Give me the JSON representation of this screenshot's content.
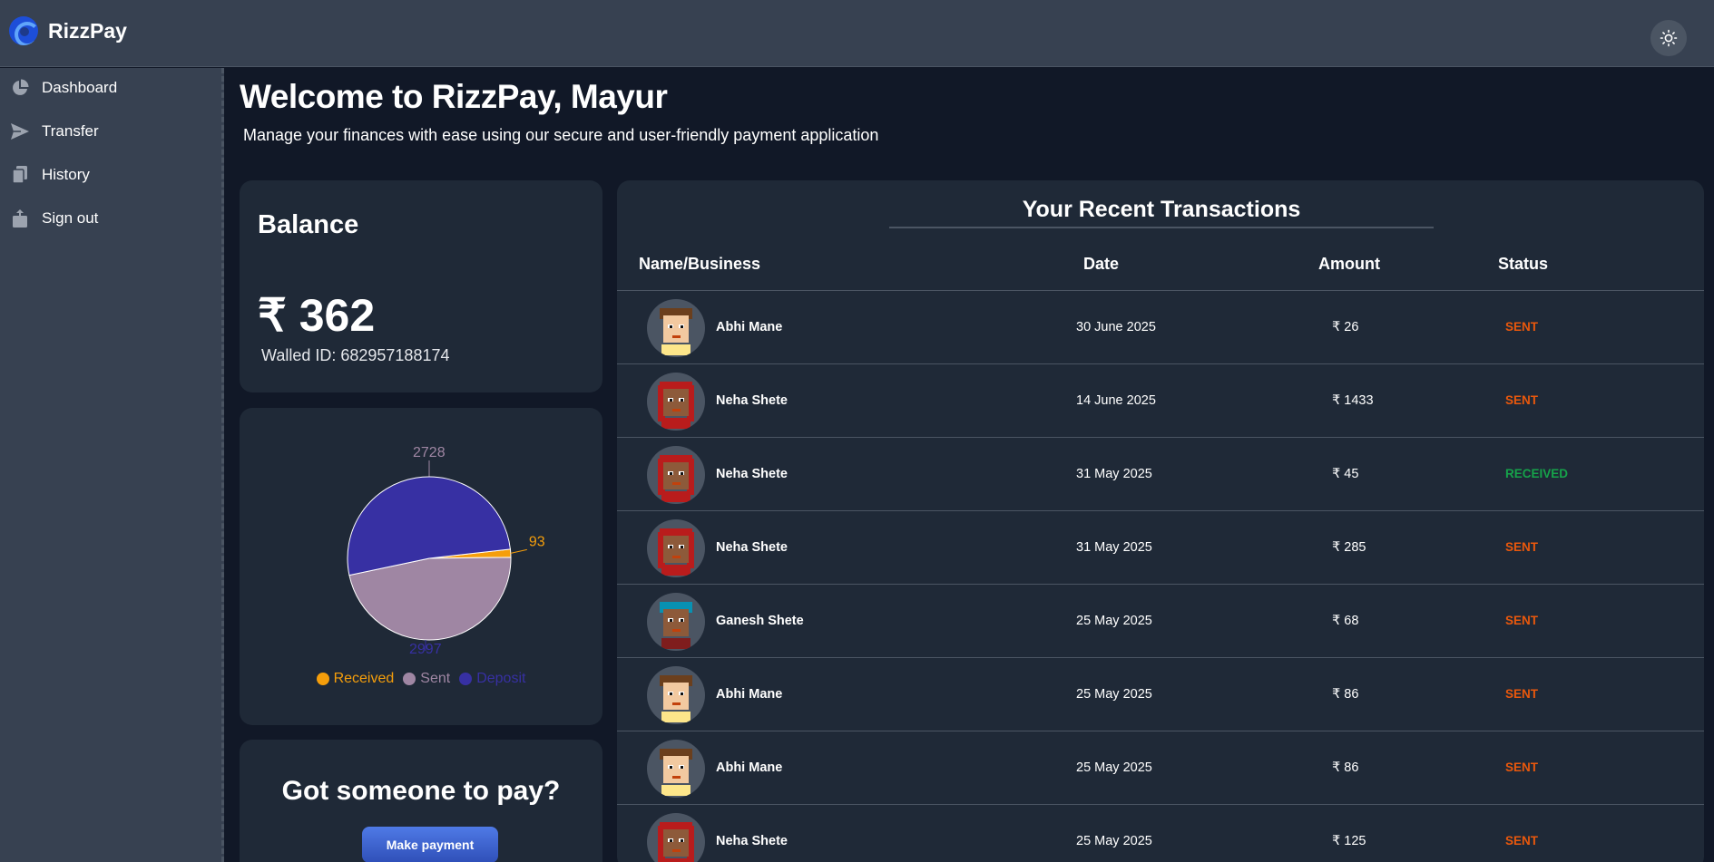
{
  "app": {
    "name": "RizzPay"
  },
  "sidebar": {
    "items": [
      {
        "label": "Dashboard",
        "icon": "pie-chart-icon"
      },
      {
        "label": "Transfer",
        "icon": "send-icon"
      },
      {
        "label": "History",
        "icon": "documents-icon"
      },
      {
        "label": "Sign out",
        "icon": "sign-out-icon"
      }
    ]
  },
  "header": {
    "title": "Welcome to RizzPay, Mayur",
    "subtitle": "Manage your finances with ease using our secure and user-friendly payment application"
  },
  "balance": {
    "title": "Balance",
    "amount": "₹ 362",
    "wallet_id": "Walled ID: 682957188174"
  },
  "chart_data": {
    "type": "pie",
    "slices": [
      {
        "name": "Received",
        "value": 93,
        "color": "#f59e0b"
      },
      {
        "name": "Sent",
        "value": 2728,
        "color": "#9f86a3"
      },
      {
        "name": "Deposit",
        "value": 2997,
        "color": "#3730a3"
      }
    ],
    "legend": "bottom"
  },
  "pay_card": {
    "title": "Got someone to pay?",
    "button": "Make payment"
  },
  "transactions": {
    "title": "Your Recent Transactions",
    "columns": [
      "Name/Business",
      "Date",
      "Amount",
      "Status"
    ],
    "rows": [
      {
        "name": "Abhi Mane",
        "date": "30 June 2025",
        "amount": "₹ 26",
        "status": "SENT",
        "avatar": "abhi"
      },
      {
        "name": "Neha Shete",
        "date": "14 June 2025",
        "amount": "₹ 1433",
        "status": "SENT",
        "avatar": "neha"
      },
      {
        "name": "Neha Shete",
        "date": "31 May 2025",
        "amount": "₹ 45",
        "status": "RECEIVED",
        "avatar": "neha"
      },
      {
        "name": "Neha Shete",
        "date": "31 May 2025",
        "amount": "₹ 285",
        "status": "SENT",
        "avatar": "neha"
      },
      {
        "name": "Ganesh Shete",
        "date": "25 May 2025",
        "amount": "₹ 68",
        "status": "SENT",
        "avatar": "ganesh"
      },
      {
        "name": "Abhi Mane",
        "date": "25 May 2025",
        "amount": "₹ 86",
        "status": "SENT",
        "avatar": "abhi"
      },
      {
        "name": "Abhi Mane",
        "date": "25 May 2025",
        "amount": "₹ 86",
        "status": "SENT",
        "avatar": "abhi"
      },
      {
        "name": "Neha Shete",
        "date": "25 May 2025",
        "amount": "₹ 125",
        "status": "SENT",
        "avatar": "neha"
      }
    ]
  },
  "colors": {
    "sent": "#ea580c",
    "received": "#16a34a",
    "accent": "#3b63d6"
  }
}
